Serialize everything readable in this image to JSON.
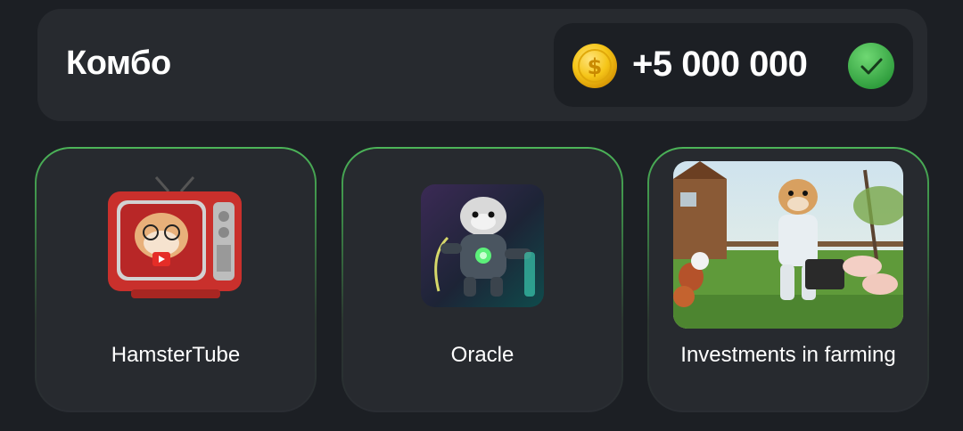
{
  "combo": {
    "title": "Комбо",
    "reward_amount": "+5 000 000",
    "coin_icon": "coin-icon",
    "status_icon": "check-icon"
  },
  "cards": [
    {
      "label": "HamsterTube",
      "image": "hamster-tv-image"
    },
    {
      "label": "Oracle",
      "image": "hamster-robot-image"
    },
    {
      "label": "Investments in farming",
      "image": "hamster-farm-image"
    }
  ],
  "colors": {
    "background": "#1c1f24",
    "panel": "#272a2f",
    "accent_green": "#4cb559",
    "coin_gold": "#f5c518"
  }
}
